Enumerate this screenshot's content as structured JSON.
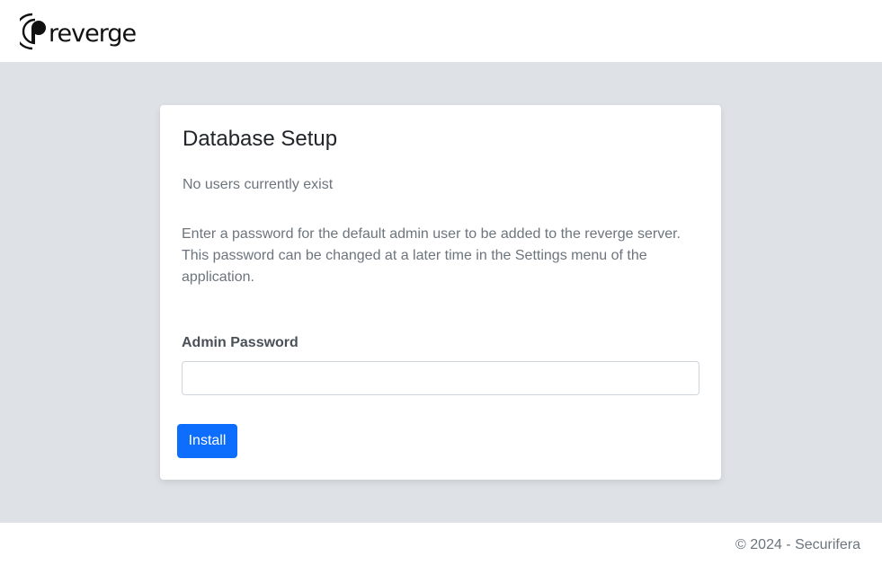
{
  "navbar": {
    "brand_text": "reverge",
    "logo_icon": "reverge-signal-logo"
  },
  "card": {
    "title": "Database Setup",
    "subtitle": "No users currently exist",
    "description": "Enter a password for the default admin user to be added to the reverge server. This password can be changed at a later time in the Settings menu of the application.",
    "password_label": "Admin Password",
    "password_value": "",
    "install_label": "Install"
  },
  "footer": {
    "copyright": "© 2024 - Securifera"
  },
  "colors": {
    "primary": "#0d6efd",
    "background": "#dee2e6",
    "muted_text": "#6c757d"
  }
}
